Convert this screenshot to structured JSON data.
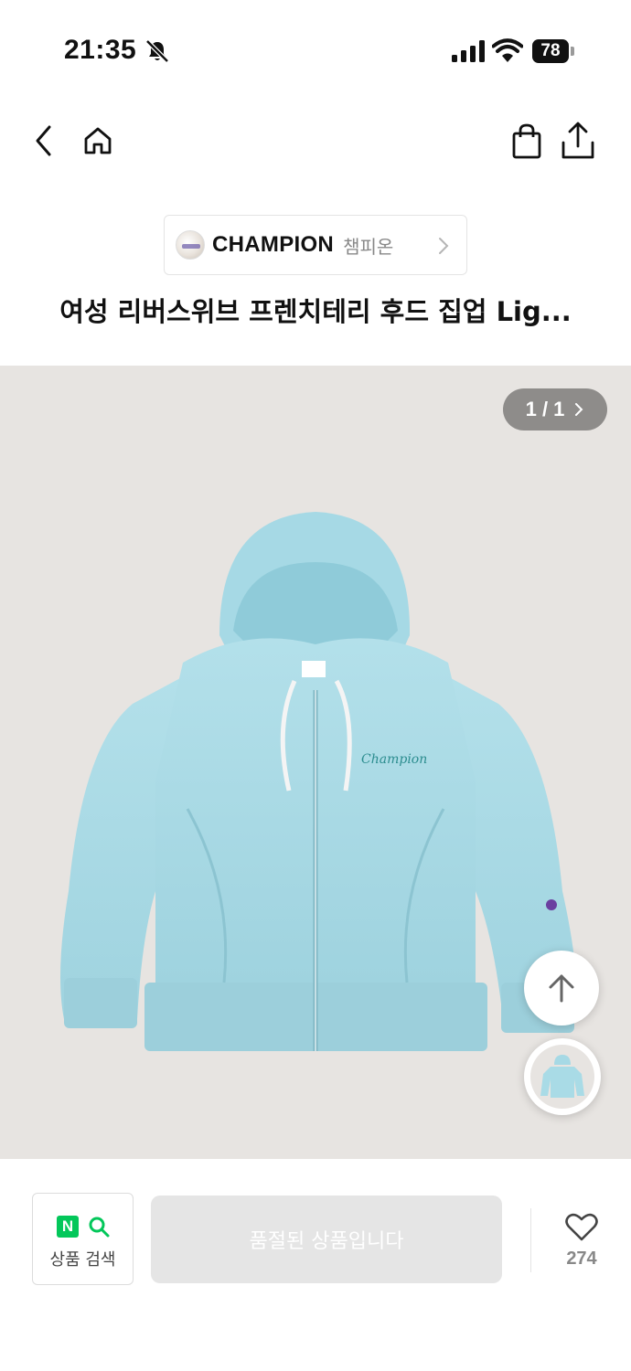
{
  "status_bar": {
    "time": "21:35",
    "battery": "78"
  },
  "nav": {
    "back": "back",
    "home": "home",
    "bag": "shopping-bag",
    "share": "share"
  },
  "brand": {
    "name_en": "CHAMPION",
    "name_ko": "챔피온"
  },
  "product": {
    "title": "여성 리버스위브 프렌치테리 후드 집업 Lig..."
  },
  "gallery": {
    "page_current": "1",
    "page_total": "1",
    "page_label": "1 / 1"
  },
  "bottom": {
    "naver_badge": "N",
    "naver_label": "상품 검색",
    "sold_out_label": "품절된 상품입니다",
    "like_count": "274"
  },
  "colors": {
    "hoodie": "#a9dbe6",
    "background": "#e7e4e1",
    "naver_green": "#03c75a"
  }
}
